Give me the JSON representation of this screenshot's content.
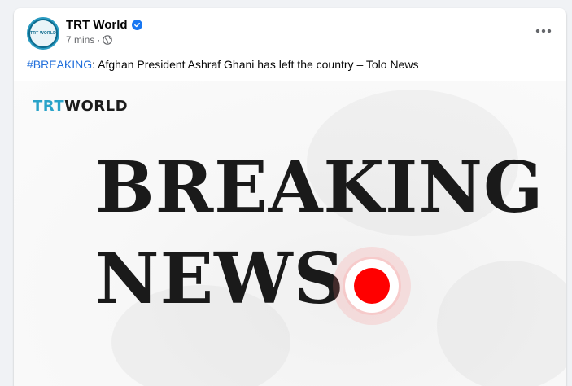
{
  "post": {
    "page_name": "TRT World",
    "avatar_text": "TRT WORLD",
    "timestamp": "7 mins",
    "separator": "·",
    "hashtag": "#BREAKING",
    "text": ": Afghan President Ashraf Ghani has left the country – Tolo News"
  },
  "media": {
    "brand_trt": "TRT",
    "brand_world": "WORLD",
    "headline_line1": "BREAKING",
    "headline_line2": "NEWS"
  },
  "colors": {
    "verified": "#1877f2",
    "hashtag": "#216fdb",
    "brand_accent": "#2aa3c9",
    "live_dot": "#ff0000"
  },
  "icons": [
    "verified-badge-icon",
    "globe-icon",
    "more-options-icon",
    "live-dot-icon"
  ]
}
